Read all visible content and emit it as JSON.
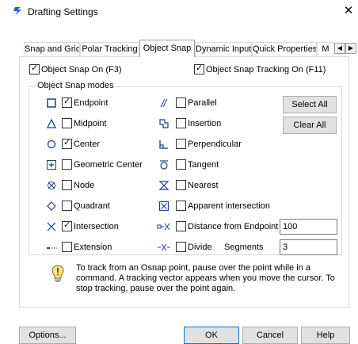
{
  "window": {
    "title": "Drafting Settings",
    "close_glyph": "✕"
  },
  "tabs": [
    {
      "label": "Snap and Grid"
    },
    {
      "label": "Polar Tracking"
    },
    {
      "label": "Object Snap"
    },
    {
      "label": "Dynamic Input"
    },
    {
      "label": "Quick Properties"
    },
    {
      "label": "M"
    }
  ],
  "top_options": {
    "snap_on": {
      "label": "Object Snap On (F3)",
      "checked": true
    },
    "tracking_on": {
      "label": "Object Snap Tracking On (F11)",
      "checked": true
    }
  },
  "group": {
    "title": "Object Snap modes"
  },
  "modes_left": [
    {
      "label": "Endpoint",
      "checked": true,
      "icon": "square-icon"
    },
    {
      "label": "Midpoint",
      "checked": false,
      "icon": "triangle-icon"
    },
    {
      "label": "Center",
      "checked": true,
      "icon": "circle-icon"
    },
    {
      "label": "Geometric Center",
      "checked": false,
      "icon": "plus-box-icon"
    },
    {
      "label": "Node",
      "checked": false,
      "icon": "node-icon"
    },
    {
      "label": "Quadrant",
      "checked": false,
      "icon": "diamond-icon"
    },
    {
      "label": "Intersection",
      "checked": true,
      "icon": "x-icon"
    },
    {
      "label": "Extension",
      "checked": false,
      "icon": "extension-icon"
    }
  ],
  "modes_right": [
    {
      "label": "Parallel",
      "checked": false,
      "icon": "parallel-icon"
    },
    {
      "label": "Insertion",
      "checked": false,
      "icon": "insertion-icon"
    },
    {
      "label": "Perpendicular",
      "checked": false,
      "icon": "perpendicular-icon"
    },
    {
      "label": "Tangent",
      "checked": false,
      "icon": "tangent-icon"
    },
    {
      "label": "Nearest",
      "checked": false,
      "icon": "hourglass-icon"
    },
    {
      "label": "Apparent intersection",
      "checked": false,
      "icon": "boxed-x-icon"
    },
    {
      "label": "Distance from Endpoint",
      "checked": false,
      "icon": "distance-icon"
    },
    {
      "label": "Divide",
      "checked": false,
      "icon": "divide-icon"
    }
  ],
  "buttons": {
    "select_all": "Select All",
    "clear_all": "Clear All"
  },
  "fields": {
    "distance_value": "100",
    "segments_label": "Segments",
    "segments_value": "3"
  },
  "hint_text": "To track from an Osnap point, pause over the point while in a command.  A tracking vector appears when you move the cursor.  To stop tracking, pause over the point again.",
  "footer": {
    "options": "Options...",
    "ok": "OK",
    "cancel": "Cancel",
    "help": "Help"
  },
  "colors": {
    "accent": "#0078d7",
    "icon_blue": "#1e3f8f"
  }
}
